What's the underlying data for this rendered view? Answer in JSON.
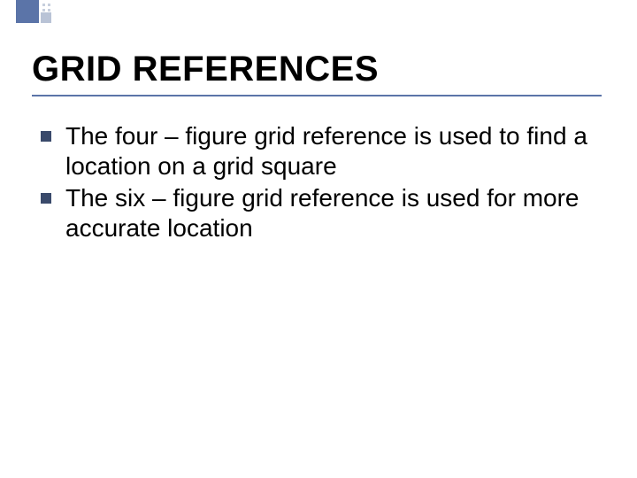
{
  "slide": {
    "title": "GRID REFERENCES",
    "bullets": [
      "The four – figure grid reference is used to find a location on a grid square",
      "The six – figure grid reference is used for more accurate location"
    ]
  }
}
